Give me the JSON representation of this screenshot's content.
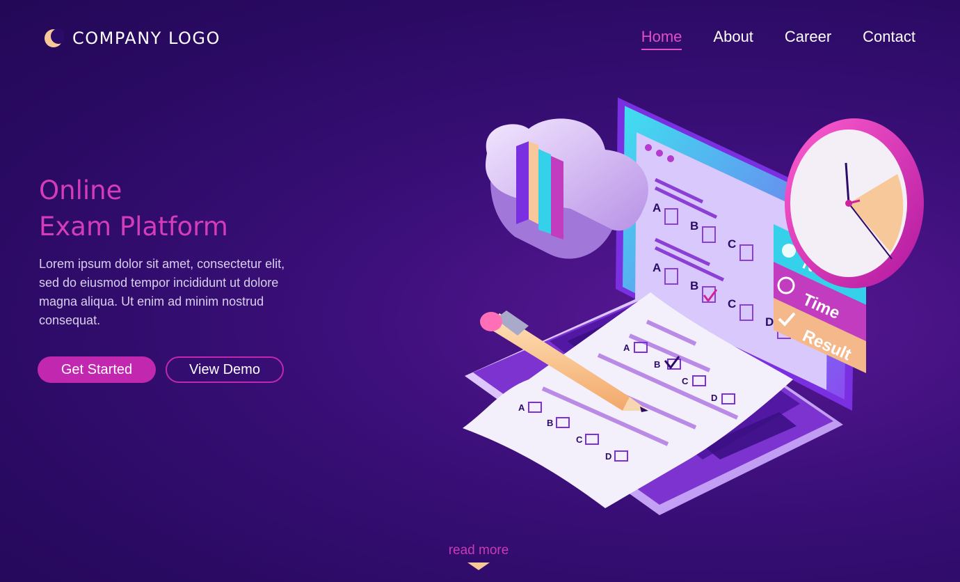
{
  "brand": {
    "logo_text": "COMPANY LOGO",
    "accent_color": "#d43cb9",
    "button_color": "#c227b0"
  },
  "nav": {
    "items": [
      "Home",
      "About",
      "Career",
      "Contact"
    ],
    "active": "Home"
  },
  "hero": {
    "title_line1": "Online",
    "title_line2": "Exam Platform",
    "description": "Lorem ipsum dolor sit amet, consectetur elit, sed do eiusmod tempor incididunt ut dolore magna aliqua. Ut enim ad minim nostrud consequat.",
    "primary_button": "Get Started",
    "secondary_button": "View Demo"
  },
  "footer": {
    "read_more": "read more"
  },
  "illustration": {
    "screen_form_labels": [
      "A",
      "B",
      "C",
      "A",
      "B",
      "C",
      "D"
    ],
    "paper_labels": [
      "A",
      "B",
      "C",
      "D",
      "A",
      "B",
      "C",
      "D"
    ],
    "screen_tabs": [
      "Name",
      "Time",
      "Result"
    ],
    "icons": [
      "cloud-icon",
      "books-icon",
      "clock-icon",
      "pencil-icon",
      "laptop-icon",
      "user-icon",
      "timer-icon",
      "check-icon"
    ]
  }
}
